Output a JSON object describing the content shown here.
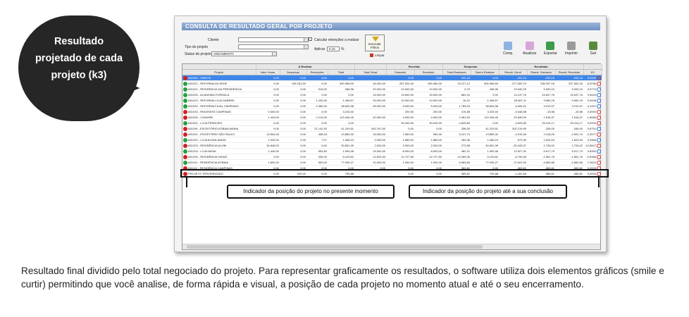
{
  "bubble": {
    "line1": "Resultado",
    "line2": "projetado de cada",
    "line3": "projeto (k3)"
  },
  "window": {
    "title": "CONSULTA DE RESULTADO GERAL POR PROJETO"
  },
  "filters": {
    "cliente_label": "Cliente",
    "tipo_label": "Tipo do projeto",
    "status_label": "Status do projeto",
    "status_value": "ANDAMENTO",
    "calcular_label": "Calcular retenções a realizar",
    "aplicar_label": "Aplicar",
    "aplicar_value": "0,15",
    "percent": "%",
    "executar_label": "Executar Filtros",
    "limpar_label": "Limpar"
  },
  "toolbar": {
    "comp": "Comp.",
    "atualizar": "Atualizar",
    "exportar": "Exportar",
    "imprimir": "Imprimir",
    "sair": "Sair"
  },
  "groups": {
    "a_realizar": "A Realizar",
    "receitas": "Receitas",
    "despesas": "Despesas",
    "resultado": "Resultado"
  },
  "columns": [
    "Projeto",
    "Valor Horas",
    "Despesas",
    "Retenções",
    "Total",
    "Total Geral",
    "Faturado",
    "Recebido",
    "Total Realizado",
    "Total a Realizar",
    "Result. Geral",
    "Result. Faturado",
    "Result. Recebido",
    "K3"
  ],
  "rows": [
    {
      "status": "sad",
      "name": "A51000 - OBOFIX",
      "vals": [
        "0,00",
        "0,00",
        "0,00",
        "0,00",
        "",
        "0,00",
        "0,00",
        "292,18",
        "0,00",
        "-292,18",
        "-292,18",
        "-292,18",
        "0,0000"
      ],
      "selected": true
    },
    {
      "status": "happy",
      "name": "A51022 - REFORMA DA SEDE",
      "vals": [
        "0,00",
        "105.181,50",
        "0,00",
        "300.956,59",
        "46.000,00",
        "257.524,30",
        "259.489,30",
        "19.127,12",
        "300.956,59",
        "-277.083,70",
        "238.397,18",
        "237.362,18",
        "-6,0236"
      ]
    },
    {
      "status": "happy",
      "name": "A51022 - RESIDÊNCIA DA PRESIDÊNCIA",
      "vals": [
        "0,00",
        "0,00",
        "915,00",
        "458,96",
        "20.000,00",
        "10.000,00",
        "10.000,00",
        "0,75",
        "458,96",
        "19.540,29",
        "9.999,24",
        "9.999,24",
        "0,9770"
      ]
    },
    {
      "status": "happy",
      "name": "A51025 - ACADEMIA FORMULA",
      "vals": [
        "0,00",
        "0,00",
        "0,00",
        "0,00",
        "15.000,00",
        "15.500,00",
        "15.500,00",
        "862,24",
        "0,00",
        "14.137,76",
        "15.637,76",
        "15.637,76",
        "0,9425"
      ]
    },
    {
      "status": "happy",
      "name": "A51023 - REFORMA LOJA GABRIEL",
      "vals": [
        "0,00",
        "0,00",
        "1.230,00",
        "1.496,57",
        "30.000,00",
        "10.000,00",
        "10.000,00",
        "16,22",
        "1.496,57",
        "28.487,11",
        "9.983,78",
        "9.983,78",
        "0,9496"
      ]
    },
    {
      "status": "happy",
      "name": "A51032 - REFORMA FILIAL CAMPINAS",
      "vals": [
        "0,00",
        "0,00",
        "2.480,00",
        "38.826,98",
        "45.000,00",
        "5.000,00",
        "5.000,00",
        "1.789,03",
        "38.826,98",
        "6.284,91",
        "3.210,97",
        "3.210,97",
        "0,1397"
      ]
    },
    {
      "status": "sad",
      "name": "A51033 - REASSESS CAMPINAS",
      "vals": [
        "3.000,00",
        "0,00",
        "0,00",
        "3.233,40",
        "",
        "200,00",
        "200,00",
        "215,58",
        "3.233,40",
        "-3.448,98",
        "-15,58",
        "-15,58",
        "0,0000"
      ]
    },
    {
      "status": "sad",
      "name": "A51035 - COMURB",
      "vals": [
        "1.440,00",
        "0,00",
        "2.214,00",
        "113.346,45",
        "40.000,00",
        "4.000,00",
        "4.000,00",
        "2.481,53",
        "113.346,45",
        "-75.830,09",
        "1.518,37",
        "1.518,37",
        "-1,8956"
      ]
    },
    {
      "status": "happy",
      "name": "A51051 - LOJA PERDIZES",
      "vals": [
        "0,00",
        "0,00",
        "0,00",
        "0,00",
        "",
        "30.040,00",
        "30.040,00",
        "4.625,83",
        "0,00",
        "-4.625,83",
        "25.414,17",
        "25.414,17",
        "0,0000"
      ]
    },
    {
      "status": "sad",
      "name": "A51199 - ESCRITÓRIO ATIBAIA MANIA",
      "vals": [
        "0,00",
        "0,00",
        "21.142,93",
        "41.229,51",
        "343.767,50",
        "0,00",
        "0,00",
        "336,00",
        "41.229,51",
        "302.219,99",
        "-336,00",
        "-336,00",
        "0,8791"
      ]
    },
    {
      "status": "sad",
      "name": "A51201 - ESCRITÓRIO SÃO PAULO",
      "vals": [
        "13.504,00",
        "0,00",
        "458,18",
        "13.883,32",
        "15.000,00",
        "7.550,00",
        "550,00",
        "5.121,74",
        "13.883,32",
        "-4.015,06",
        "2.418,26",
        "-4.591,74",
        "-0,2577"
      ]
    },
    {
      "status": "happy",
      "name": "A51202 - LOJA ALVINLANDIA",
      "vals": [
        "1.440,00",
        "0,00",
        "7,07",
        "1.066,24",
        "2.000,00",
        "1.885,00",
        "1.885,00",
        "260,46",
        "1.066,24",
        "673,30",
        "1.624,54",
        "1.624,54",
        "0,3366"
      ]
    },
    {
      "status": "sad",
      "name": "A51203 - RESIDÊNCIA ALVIM",
      "vals": [
        "34.848,00",
        "0,00",
        "0,00",
        "30.831,39",
        "2.000,00",
        "2.000,00",
        "2.000,00",
        "273,98",
        "30.831,39",
        "-29.105,37",
        "1.726,02",
        "1.726,02",
        "-14,5527"
      ]
    },
    {
      "status": "happy",
      "name": "A51204 - LOJA NATAL",
      "vals": [
        "1.440,00",
        "0,00",
        "553,50",
        "1.990,48",
        "15.000,00",
        "8.000,00",
        "8.000,00",
        "482,21",
        "1.990,48",
        "12.527,31",
        "5.517,79",
        "5.517,79",
        "0,8352"
      ]
    },
    {
      "status": "sad",
      "name": "A51205 - RESIDÊNCIA HATAS",
      "vals": [
        "0,00",
        "0,00",
        "335,20",
        "5.129,82",
        "12.620,00",
        "12.727,50",
        "12.727,50",
        "14.289,26",
        "5.129,82",
        "-6.799,08",
        "-1.561,76",
        "-1.561,76",
        "-0,5388"
      ]
    },
    {
      "status": "happy",
      "name": "A51101 - RESIDÊNCIA ATIBAIA",
      "vals": [
        "1.800,00",
        "0,00",
        "563,00",
        "77.039,27",
        "10.000,00",
        "1.000,00",
        "1.000,00",
        "5.583,66",
        "77.039,27",
        "-72.622,93",
        "-4.583,66",
        "-4.583,66",
        "-7,2623"
      ],
      "marked": true
    },
    {
      "status": "sad",
      "name": "A51110 - RESIDÊNCIA CAMPINAS",
      "vals": [
        "0,00",
        "0,00",
        "0,00",
        "0,00",
        "0,00",
        "0,00",
        "0,00",
        "369,81",
        "0,00",
        "-369,81",
        "-369,81",
        "-369,81",
        "0,0000"
      ]
    },
    {
      "status": "sad",
      "name": "PROJETO TERCEIRIZADO",
      "vals": [
        "0,00",
        "100,00",
        "0,00",
        "795,88",
        "",
        "0,00",
        "0,00",
        "385,81",
        "795,88",
        "-1.181,69",
        "-385,81",
        "-385,81",
        "0,0000"
      ]
    }
  ],
  "totals": [
    "",
    "",
    "105.281,50",
    "29.550,28",
    "634.586,04",
    "601.382,50",
    "363.971,80",
    "355.936,80",
    "56.511,42",
    "634.586,04",
    "-89.534,96",
    "307.460,38",
    "299.425,38",
    ""
  ],
  "annotations": {
    "left": "Indicador da posição do projeto no presente momento",
    "right": "Indicador da posição do projeto até a sua conclusão"
  },
  "caption": "Resultado final dividido pelo total negociado do projeto. Para representar graficamente os resultados, o software utiliza dois elementos gráficos (smile e curtir) permitindo que você analise, de forma rápida e visual, a posição de cada projeto no momento atual e até o seu encerramento."
}
